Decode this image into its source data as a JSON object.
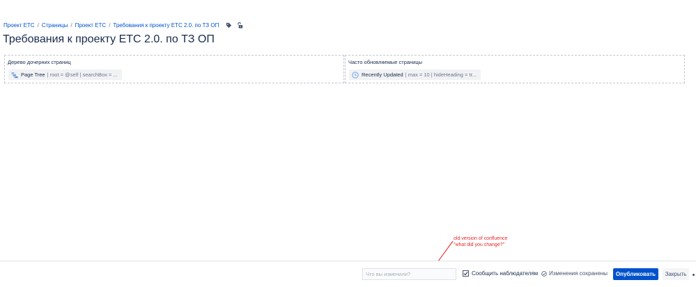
{
  "breadcrumb": {
    "items": [
      "Проект ЕТС",
      "Страницы",
      "Проект ЕТС",
      "Требования к проекту ЕТС 2.0. по ТЗ ОП"
    ],
    "separator": "/",
    "icons": [
      "label-icon",
      "unlock-icon"
    ]
  },
  "page": {
    "title": "Требования к проекту ЕТС 2.0. по ТЗ ОП"
  },
  "sections": [
    {
      "heading": "Дерево дочерних страниц",
      "macro": {
        "name": "Page Tree",
        "params": "| root = @self | searchBox = ...",
        "icon": "page-tree-icon"
      }
    },
    {
      "heading": "Часто обновляемые страницы",
      "macro": {
        "name": "Recently Updated",
        "params": "| max = 10 | hideHeading = tr...",
        "icon": "clock-icon"
      }
    }
  ],
  "annotation": {
    "line1": "old version of confluence",
    "line2": "\"what did you change?\"",
    "color": "#e8262a"
  },
  "bottom_bar": {
    "comment_placeholder": "Что вы изменили?",
    "comment_value": "",
    "notify_label": "Сообщить наблюдателям",
    "notify_checked": true,
    "saved_status": "Изменения сохранены",
    "publish_label": "Опубликовать",
    "close_label": "Закрыть"
  },
  "colors": {
    "link": "#0052cc",
    "primary_button": "#0052cc",
    "text": "#172b4d"
  }
}
